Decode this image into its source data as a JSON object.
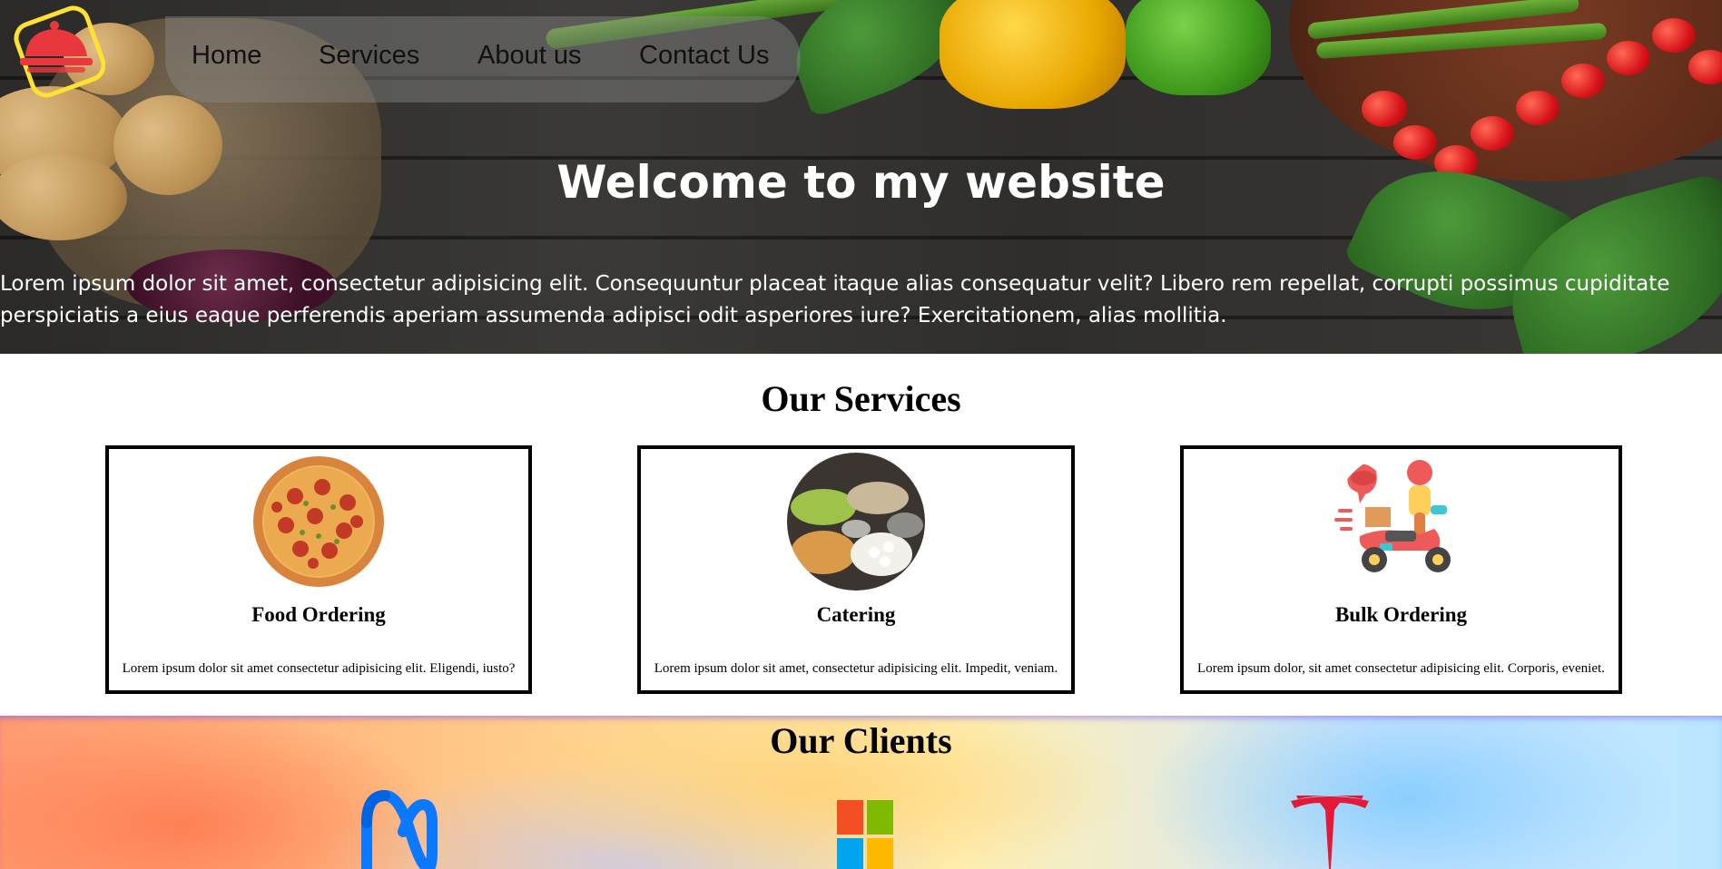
{
  "nav": {
    "logo_icon": "chef-hat-logo-icon",
    "links": [
      "Home",
      "Services",
      "About us",
      "Contact Us"
    ]
  },
  "hero": {
    "title": "Welcome to my website",
    "text": "Lorem ipsum dolor sit amet, consectetur adipisicing elit. Consequuntur placeat itaque alias consequatur velit? Libero rem repellat, corrupti possimus cupiditate perspiciatis a eius eaque perferendis aperiam assumenda adipisci odit asperiores iure? Exercitationem, alias mollitia."
  },
  "services": {
    "title": "Our Services",
    "cards": [
      {
        "icon": "pizza-icon",
        "title": "Food Ordering",
        "text": "Lorem ipsum dolor sit amet consectetur adipisicing elit. Eligendi, iusto?"
      },
      {
        "icon": "catering-buffet-icon",
        "title": "Catering",
        "text": "Lorem ipsum dolor sit amet, consectetur adipisicing elit. Impedit, veniam."
      },
      {
        "icon": "delivery-scooter-icon",
        "title": "Bulk Ordering",
        "text": "Lorem ipsum dolor, sit amet consectetur adipisicing elit. Corporis, eveniet."
      }
    ]
  },
  "clients": {
    "title": "Our Clients",
    "logos": [
      "meta-logo-icon",
      "microsoft-logo-icon",
      "tesla-logo-icon"
    ]
  },
  "colors": {
    "logo_accent": "#ffe033",
    "logo_red": "#e8383d",
    "hero_text": "#ffffff",
    "card_border": "#000000"
  }
}
